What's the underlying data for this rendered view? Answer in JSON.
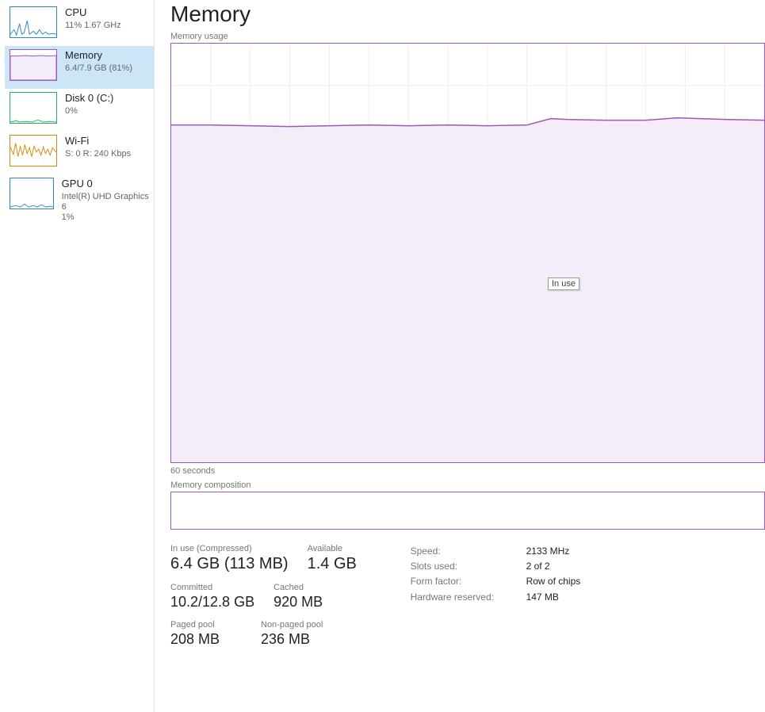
{
  "sidebar": {
    "items": [
      {
        "title": "CPU",
        "sub": "11%  1.67 GHz"
      },
      {
        "title": "Memory",
        "sub": "6.4/7.9 GB (81%)"
      },
      {
        "title": "Disk 0 (C:)",
        "sub": "0%"
      },
      {
        "title": "Wi-Fi",
        "sub": "S: 0 R: 240 Kbps"
      },
      {
        "title": "GPU 0",
        "sub": "Intel(R) UHD Graphics 6\n1%"
      }
    ]
  },
  "header": {
    "title": "Memory"
  },
  "chart": {
    "usage_label": "Memory usage",
    "axis_label": "60 seconds",
    "composition_label": "Memory composition",
    "tooltip": "In use"
  },
  "chart_data": {
    "type": "area",
    "title": "Memory usage",
    "xlabel": "60 seconds",
    "ylabel": "",
    "ylim": [
      0,
      100
    ],
    "series": [
      {
        "name": "Memory usage %",
        "values": [
          81,
          81,
          81,
          80.5,
          81,
          81,
          81,
          81,
          80.8,
          81,
          82.5,
          82,
          82,
          82.5,
          82,
          82
        ]
      }
    ]
  },
  "stats": {
    "in_use_label": "In use (Compressed)",
    "in_use_value": "6.4 GB (113 MB)",
    "available_label": "Available",
    "available_value": "1.4 GB",
    "committed_label": "Committed",
    "committed_value": "10.2/12.8 GB",
    "cached_label": "Cached",
    "cached_value": "920 MB",
    "paged_label": "Paged pool",
    "paged_value": "208 MB",
    "nonpaged_label": "Non-paged pool",
    "nonpaged_value": "236 MB"
  },
  "specs": {
    "rows": [
      {
        "key": "Speed:",
        "val": "2133 MHz"
      },
      {
        "key": "Slots used:",
        "val": "2 of 2"
      },
      {
        "key": "Form factor:",
        "val": "Row of chips"
      },
      {
        "key": "Hardware reserved:",
        "val": "147 MB"
      }
    ]
  },
  "colors": {
    "memory": "#9b59b6",
    "memory_fill": "#f4ecf8",
    "cpu": "#2e86c1",
    "disk": "#27ae60",
    "wifi": "#d68910"
  }
}
